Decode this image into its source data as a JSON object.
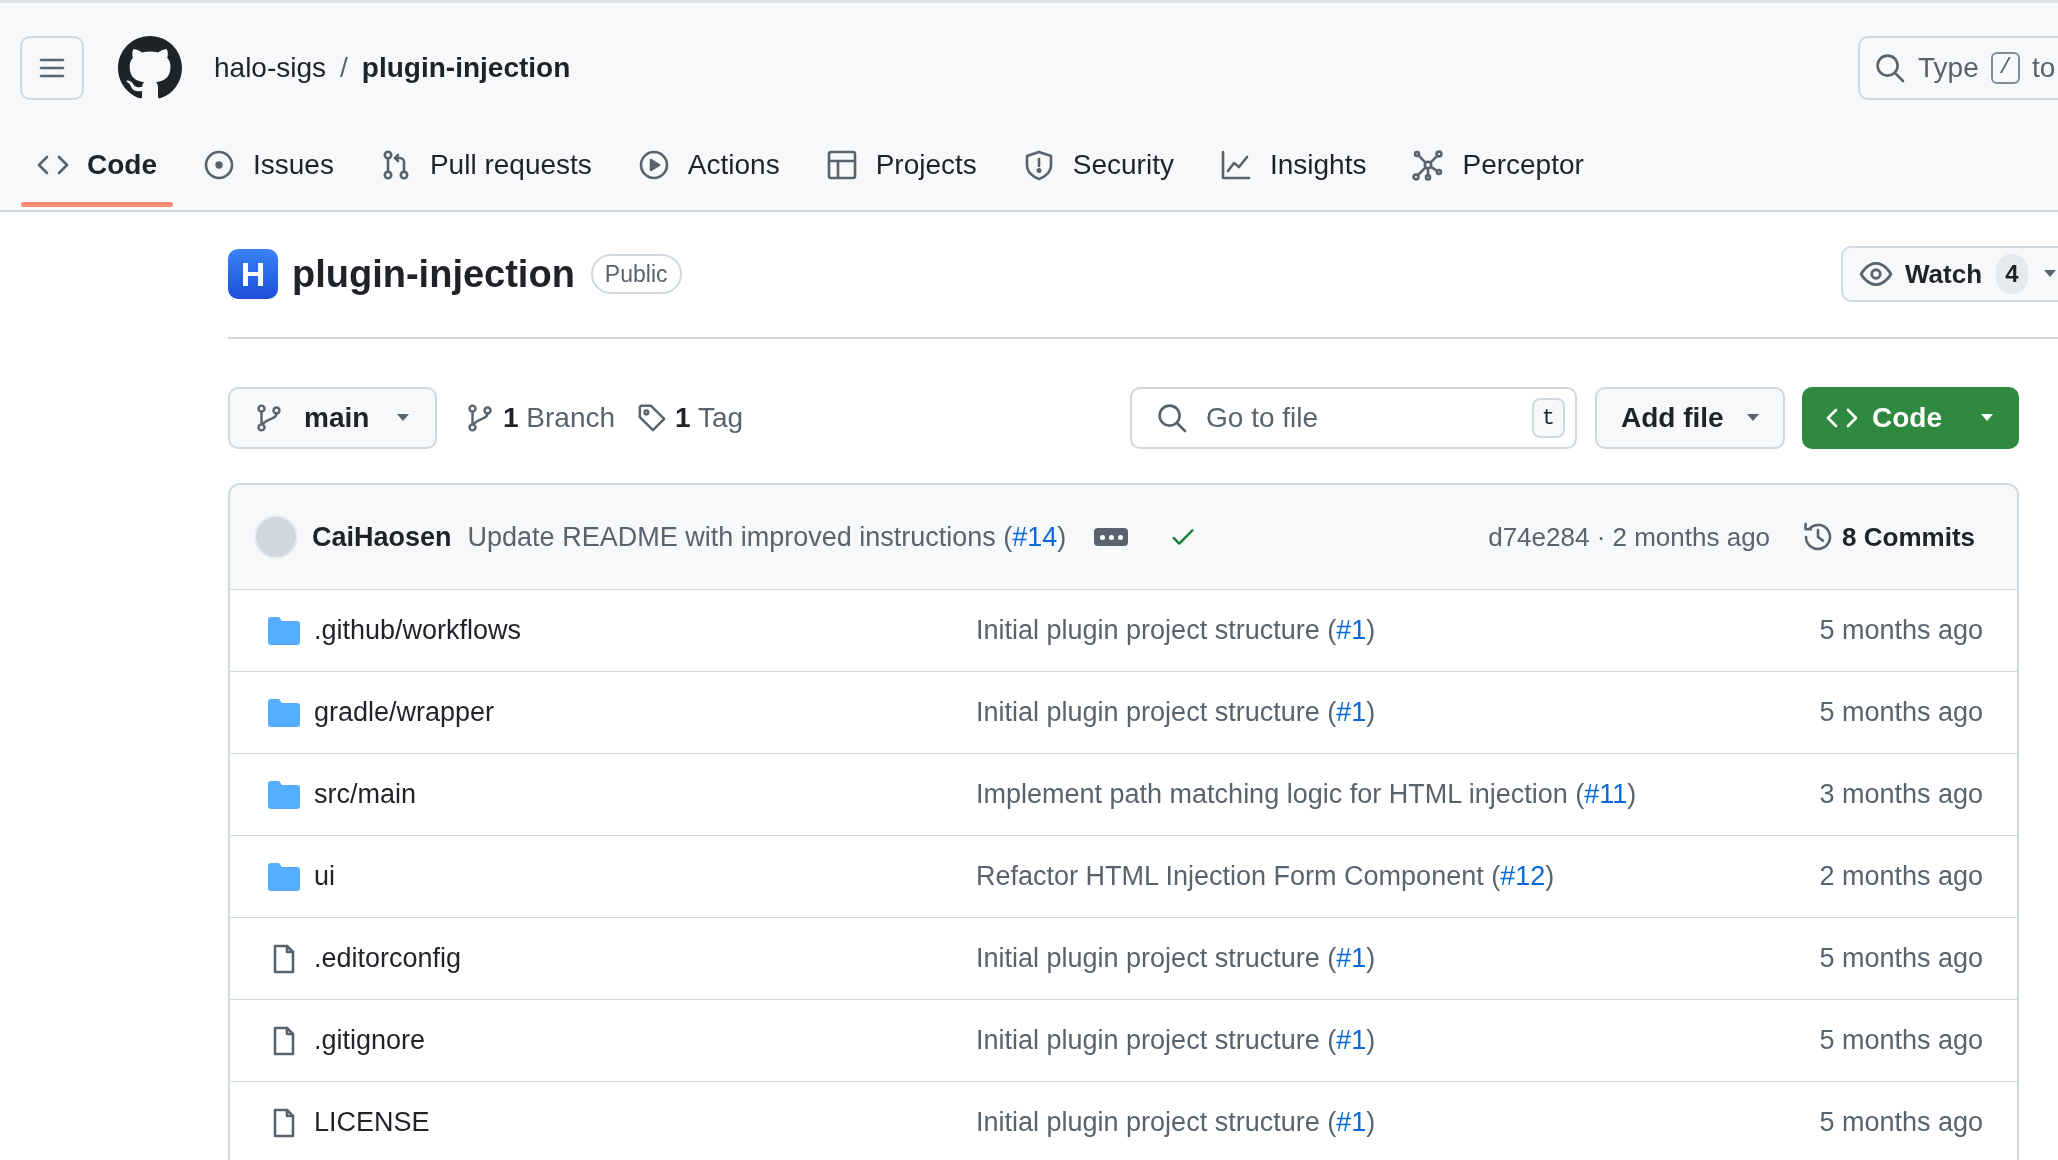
{
  "header": {
    "owner": "halo-sigs",
    "separator": "/",
    "repo": "plugin-injection",
    "search": {
      "text_before": "Type",
      "key": "/",
      "text_after": "to"
    }
  },
  "tabs": [
    {
      "label": "Code",
      "selected": true
    },
    {
      "label": "Issues",
      "selected": false
    },
    {
      "label": "Pull requests",
      "selected": false
    },
    {
      "label": "Actions",
      "selected": false
    },
    {
      "label": "Projects",
      "selected": false
    },
    {
      "label": "Security",
      "selected": false
    },
    {
      "label": "Insights",
      "selected": false
    },
    {
      "label": "Perceptor",
      "selected": false
    }
  ],
  "repo": {
    "logo_letter": "H",
    "title": "plugin-injection",
    "visibility": "Public",
    "watch": {
      "label": "Watch",
      "count": "4"
    }
  },
  "toolbar": {
    "branch": "main",
    "branches": "**1** Branch",
    "tags": "**1** Tag",
    "go_to_file": {
      "placeholder": "Go to file",
      "shortcut": "t"
    },
    "add_file": "Add file",
    "code": "Code"
  },
  "latest_commit": {
    "author": "CaiHaosen",
    "message": "Update README with improved instructions (",
    "pr": "#14",
    "suffix": ")",
    "checks_passed": true,
    "meta": "d74e284 · 2 months ago",
    "commits": "8 Commits"
  },
  "files": [
    {
      "kind": "folder",
      "name": ".github/workflows",
      "message": "Initial plugin project structure (",
      "pr": "#1",
      "suffix": ")",
      "age": "5 months ago"
    },
    {
      "kind": "folder",
      "name": "gradle/wrapper",
      "message": "Initial plugin project structure (",
      "pr": "#1",
      "suffix": ")",
      "age": "5 months ago"
    },
    {
      "kind": "folder",
      "name": "src/main",
      "message": "Implement path matching logic for HTML injection (",
      "pr": "#11",
      "suffix": ")",
      "age": "3 months ago"
    },
    {
      "kind": "folder",
      "name": "ui",
      "message": "Refactor HTML Injection Form Component (",
      "pr": "#12",
      "suffix": ")",
      "age": "2 months ago"
    },
    {
      "kind": "file",
      "name": ".editorconfig",
      "message": "Initial plugin project structure (",
      "pr": "#1",
      "suffix": ")",
      "age": "5 months ago"
    },
    {
      "kind": "file",
      "name": ".gitignore",
      "message": "Initial plugin project structure (",
      "pr": "#1",
      "suffix": ")",
      "age": "5 months ago"
    },
    {
      "kind": "file",
      "name": "LICENSE",
      "message": "Initial plugin project structure (",
      "pr": "#1",
      "suffix": ")",
      "age": "5 months ago"
    }
  ]
}
